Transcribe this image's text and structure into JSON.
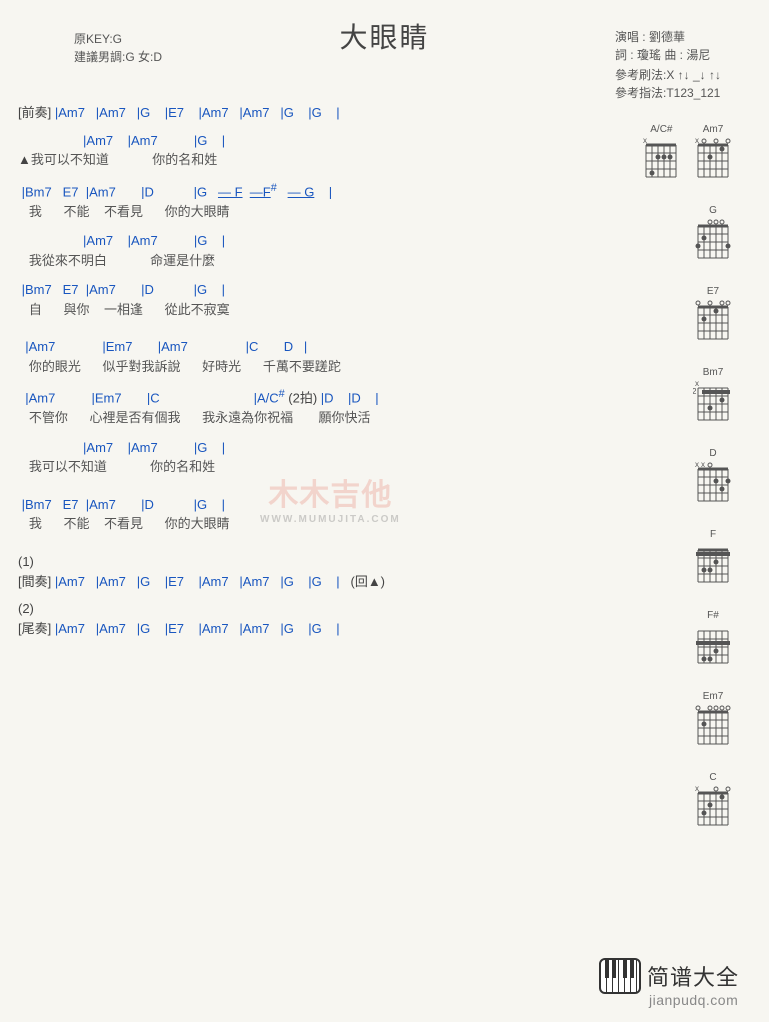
{
  "title": "大眼睛",
  "meta_left": {
    "line1": "原KEY:G",
    "line2": "建議男調:G 女:D"
  },
  "meta_right": {
    "perf_label": "演唱 : ",
    "performer": "劉德華",
    "lyric_label": "詞 : ",
    "lyricist": "瓊瑤",
    "comp_label": " 曲 : ",
    "composer": "湯尼",
    "strum_label": "參考刷法:",
    "strum": "X ↑↓ _↓ ↑↓",
    "pick_label": "參考指法:",
    "pick": "T123_121"
  },
  "lines": {
    "intro_label": "[前奏] ",
    "intro_seq": [
      "|Am7",
      "|Am7",
      "|G",
      "|E7",
      "|Am7",
      "|Am7",
      "|G",
      "|G",
      "|"
    ],
    "v1c": [
      "|Am7",
      "|Am7",
      "|G",
      "|"
    ],
    "v1l_marker": "▲",
    "v1l": "我可以不知道            你的名和姓",
    "v2c": [
      "|Bm7",
      "E7",
      "|Am7",
      "|D",
      "|G"
    ],
    "v2c_ext": [
      "— F",
      "—F",
      "#",
      "— G",
      "|"
    ],
    "v2l": "   我      不能    不看見      你的大眼睛",
    "v3c": [
      "|Am7",
      "|Am7",
      "|G",
      "|"
    ],
    "v3l": "   我從來不明白            命運是什麼",
    "v4c": [
      "|Bm7",
      "E7",
      "|Am7",
      "|D",
      "|G",
      "|"
    ],
    "v4l": "   自      與你    一相逢      從此不寂寞",
    "c1c": [
      "|Am7",
      "|Em7",
      "|Am7",
      "|C",
      "D",
      "|"
    ],
    "c1l": "   你的眼光      似乎對我訴說      好時光      千萬不要蹉跎",
    "c2c": [
      "|Am7",
      "|Em7",
      "|C",
      "|A/",
      "C",
      "#",
      " (2拍)",
      "|D",
      "|D",
      "|"
    ],
    "c2l": "   不管你      心裡是否有個我      我永遠為你祝福       願你快活",
    "v5c": [
      "|Am7",
      "|Am7",
      "|G",
      "|"
    ],
    "v5l": "   我可以不知道            你的名和姓",
    "v6c": [
      "|Bm7",
      "E7",
      "|Am7",
      "|D",
      "|G",
      "|"
    ],
    "v6l": "   我      不能    不看見      你的大眼睛",
    "sec1_num": "(1)",
    "inter_label": "[間奏] ",
    "inter_seq": [
      "|Am7",
      "|Am7",
      "|G",
      "|E7",
      "|Am7",
      "|Am7",
      "|G",
      "|G",
      "| "
    ],
    "inter_return": "(回▲)",
    "sec2_num": "(2)",
    "outro_label": "[尾奏] ",
    "outro_seq": [
      "|Am7",
      "|Am7",
      "|G",
      "|E7",
      "|Am7",
      "|Am7",
      "|G",
      "|G",
      "|"
    ]
  },
  "chord_names": [
    "A/C#",
    "Am7",
    "G",
    "E7",
    "Bm7",
    "D",
    "F",
    "F#",
    "Em7",
    "C"
  ],
  "footer": {
    "brand": "简谱大全",
    "url": "jianpudq.com"
  },
  "watermark": {
    "big": "木木吉他",
    "small": "WWW.MUMUJITA.COM"
  }
}
